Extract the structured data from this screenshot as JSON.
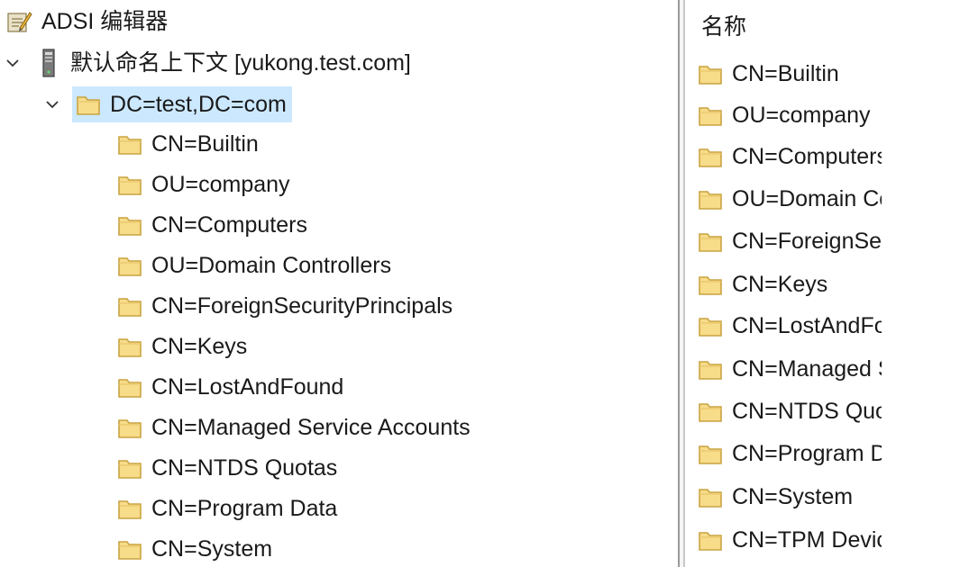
{
  "root": {
    "label": "ADSI 编辑器",
    "icon": "adsi-editor-icon"
  },
  "context": {
    "label": "默认命名上下文 [yukong.test.com]",
    "icon": "server-icon"
  },
  "domain": {
    "label": "DC=test,DC=com",
    "icon": "folder-icon",
    "selected": true
  },
  "tree_children": [
    "CN=Builtin",
    "OU=company",
    "CN=Computers",
    "OU=Domain Controllers",
    "CN=ForeignSecurityPrincipals",
    "CN=Keys",
    "CN=LostAndFound",
    "CN=Managed Service Accounts",
    "CN=NTDS Quotas",
    "CN=Program Data",
    "CN=System"
  ],
  "list": {
    "column_header": "名称",
    "items": [
      "CN=Builtin",
      "OU=company",
      "CN=Computers",
      "OU=Domain Controllers",
      "CN=ForeignSecurityPrincipals",
      "CN=Keys",
      "CN=LostAndFound",
      "CN=Managed Service Accounts",
      "CN=NTDS Quotas",
      "CN=Program Data",
      "CN=System",
      "CN=TPM Devices"
    ]
  },
  "colors": {
    "selection": "#cce8ff",
    "folder_fill": "#f7dc8a",
    "folder_stroke": "#c9a441"
  }
}
